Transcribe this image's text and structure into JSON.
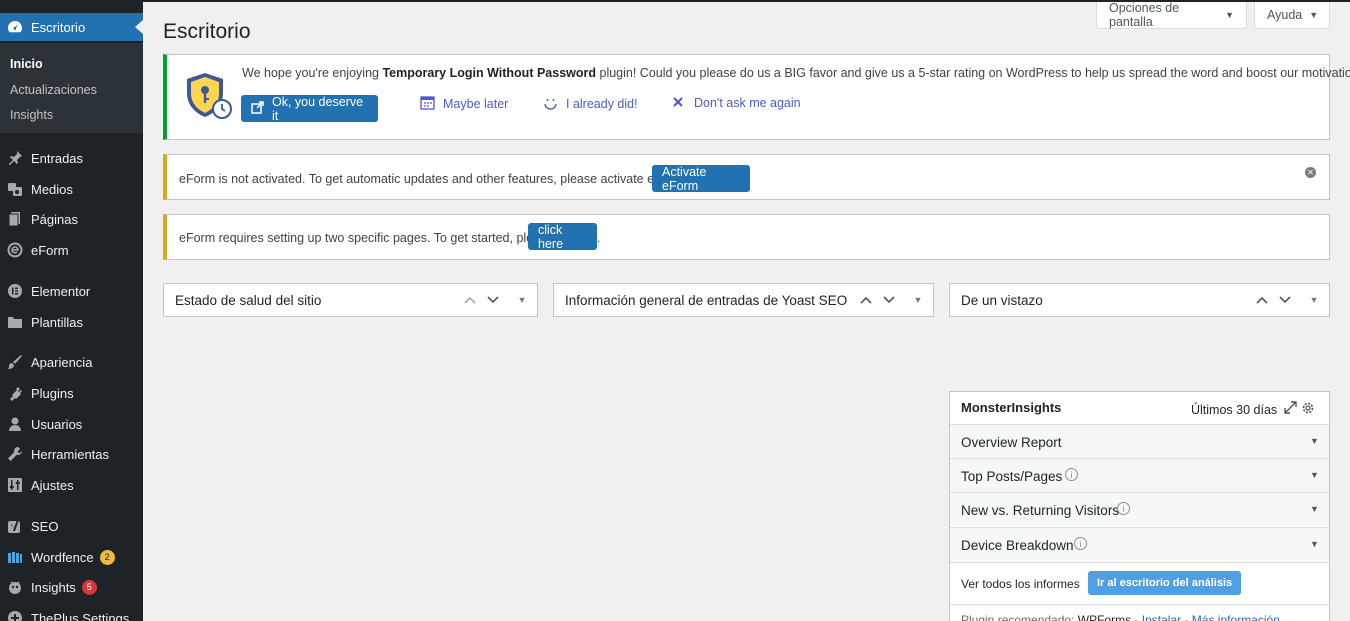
{
  "sidebar": {
    "dashboard_label": "Escritorio",
    "submenu": [
      "Inicio",
      "Actualizaciones",
      "Insights"
    ],
    "items": [
      {
        "label": "Entradas",
        "icon": "pin-icon"
      },
      {
        "label": "Medios",
        "icon": "media-icon"
      },
      {
        "label": "Páginas",
        "icon": "pages-icon"
      },
      {
        "label": "eForm",
        "icon": "eform-icon"
      },
      {
        "label": "Elementor",
        "icon": "elementor-icon"
      },
      {
        "label": "Plantillas",
        "icon": "folder-icon"
      },
      {
        "label": "Apariencia",
        "icon": "brush-icon"
      },
      {
        "label": "Plugins",
        "icon": "plug-icon"
      },
      {
        "label": "Usuarios",
        "icon": "user-icon"
      },
      {
        "label": "Herramientas",
        "icon": "wrench-icon"
      },
      {
        "label": "Ajustes",
        "icon": "settings-icon"
      },
      {
        "label": "SEO",
        "icon": "yoast-icon"
      },
      {
        "label": "Wordfence",
        "icon": "wordfence-icon",
        "badge": "2"
      },
      {
        "label": "Insights",
        "icon": "insights-icon",
        "badge": "5"
      },
      {
        "label": "ThePlus Settings",
        "icon": "theplus-icon"
      }
    ]
  },
  "header": {
    "title": "Escritorio",
    "screen_options": "Opciones de pantalla",
    "help": "Ayuda"
  },
  "notices": {
    "temp_login": {
      "text_before": "We hope you're enjoying ",
      "plugin_name": "Temporary Login Without Password",
      "text_after": " plugin! Could you please do us a BIG favor and give us a 5-star rating on WordPress to help us spread the word and boost our motivation?",
      "deserve_button": "Ok, you deserve it",
      "maybe_later": "Maybe later",
      "already_did": "I already did!",
      "dont_ask": "Don't ask me again"
    },
    "eform_activate": {
      "text": "eForm is not activated. To get automatic updates and other features, please activate eForm.",
      "button": "Activate eForm"
    },
    "eform_pages": {
      "text": "eForm requires setting up two specific pages. To get started, please",
      "button": "click here",
      "suffix": "."
    }
  },
  "postboxes": [
    "Estado de salud del sitio",
    "Información general de entradas de Yoast SEO",
    "De un vistazo"
  ],
  "monsterinsights": {
    "title": "MonsterInsights",
    "range": "Últimos 30 días",
    "rows": [
      "Overview Report",
      "Top Posts/Pages",
      "New vs. Returning Visitors",
      "Device Breakdown"
    ],
    "view_all": "Ver todos los informes",
    "analytics_button": "Ir al escritorio del análisis",
    "reco_prefix": "Plugin recomendado:",
    "reco_plugin": "WPForms",
    "reco_install": "Instalar",
    "reco_more": "Más información"
  },
  "colors": {
    "sidebar_bg": "#1d2327",
    "active_blue": "#2271b1",
    "notice_green": "#00a32a",
    "notice_yellow": "#dba617",
    "badge_orange": "#f0b849",
    "badge_red": "#d63638"
  }
}
